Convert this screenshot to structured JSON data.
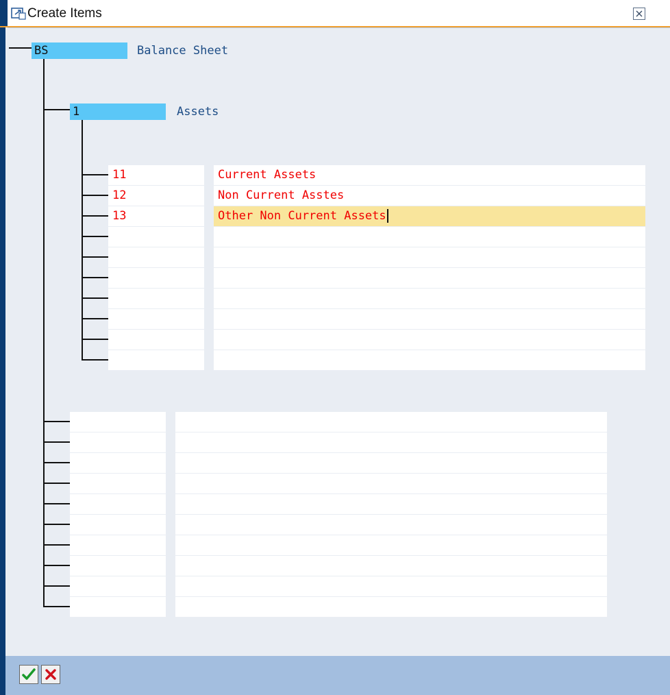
{
  "window": {
    "title": "Create Items",
    "close_icon": "close-x-icon"
  },
  "tree": {
    "root": {
      "id": "BS",
      "description": "Balance Sheet"
    },
    "level1": {
      "id": "1",
      "description": "Assets"
    },
    "items": [
      {
        "id": "11",
        "description": "Current Assets"
      },
      {
        "id": "12",
        "description": "Non Current Asstes"
      },
      {
        "id": "13",
        "description": "Other Non Current Assets"
      }
    ]
  },
  "footer": {
    "confirm_icon": "green-checkmark-icon",
    "cancel_icon": "red-x-icon"
  },
  "colors": {
    "node_highlight": "#5bc7f7",
    "item_text": "#f00000",
    "active_row": "#f9e59c",
    "title_accent": "#f0a030",
    "footer_bg": "#a3bedf"
  }
}
